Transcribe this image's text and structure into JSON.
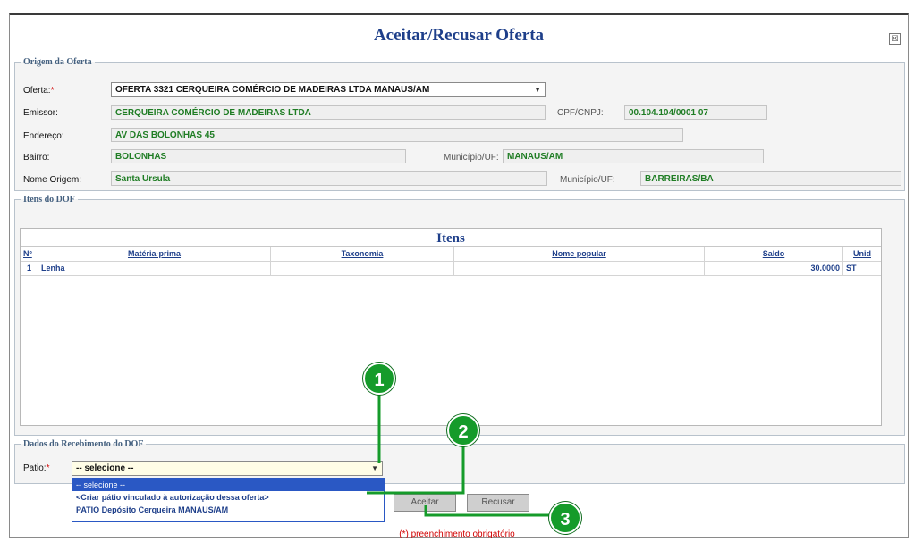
{
  "dialog": {
    "title": "Aceitar/Recusar Oferta",
    "close_label": "☒"
  },
  "origem": {
    "legend": "Origem da Oferta",
    "oferta_label": "Oferta:",
    "oferta_value": "OFERTA 3321 CERQUEIRA COMÉRCIO DE MADEIRAS LTDA MANAUS/AM",
    "emissor_label": "Emissor:",
    "emissor_value": "CERQUEIRA COMÉRCIO DE MADEIRAS LTDA",
    "cpf_label": "CPF/CNPJ:",
    "cpf_value": "00.104.104/0001 07",
    "endereco_label": "Endereço:",
    "endereco_value": "AV DAS BOLONHAS 45",
    "bairro_label": "Bairro:",
    "bairro_value": "BOLONHAS",
    "municipio_label": "Município/UF:",
    "municipio_value": "MANAUS/AM",
    "nome_origem_label": "Nome Origem:",
    "nome_origem_value": "Santa Ursula",
    "municipio2_label": "Município/UF:",
    "municipio2_value": "BARREIRAS/BA"
  },
  "itens": {
    "legend": "Itens do DOF",
    "grid_title": "Itens",
    "columns": [
      "Nº",
      "Matéria-prima",
      "Taxonomia",
      "Nome popular",
      "Saldo",
      "Unid"
    ],
    "rows": [
      {
        "n": "1",
        "materia": "Lenha",
        "taxonomia": "",
        "nome_popular": "",
        "saldo": "30.0000",
        "unid": "ST"
      }
    ]
  },
  "recebimento": {
    "legend": "Dados do Recebimento do DOF",
    "patio_label": "Patio:",
    "patio_value": "-- selecione --",
    "options": [
      "-- selecione --",
      "<Criar pátio vinculado à autorização dessa oferta>",
      "PATIO Depósito Cerqueira MANAUS/AM"
    ]
  },
  "buttons": {
    "aceitar": "Aceitar",
    "recusar": "Recusar"
  },
  "footer": {
    "note": "(*) preenchimento obrigatório"
  },
  "callouts": [
    "1",
    "2",
    "3"
  ],
  "colors": {
    "accent": "#1e3f8a",
    "value_green": "#1f7d24",
    "callout_green": "#159b2a",
    "required": "#d10000",
    "selection": "#2a58c4"
  }
}
